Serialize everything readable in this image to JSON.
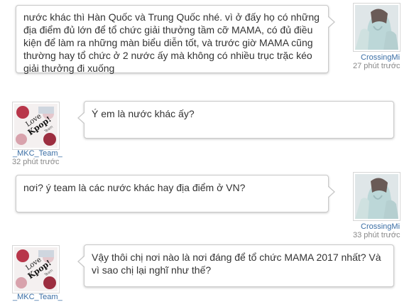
{
  "messages": [
    {
      "user": "CrossingMi",
      "time": "27 phút trước",
      "text": "nước khác thì Hàn Quốc và Trung Quốc nhé. vì ở đấy họ có những địa điểm đủ lớn để tổ chức giải thưởng tầm cỡ MAMA, có đủ điều kiện để làm ra những màn biểu diễn tốt, và trước giờ MAMA cũng thường hay tổ chức ở 2 nước ấy mà không có nhiều trục trặc kéo giải thưởng đi xuống"
    },
    {
      "user": "_MKC_Team_",
      "time": "32 phút trước",
      "text": "Ý em là nước khác ấy?",
      "avatar_text": [
        "Love",
        "Kpop!",
        "Team"
      ]
    },
    {
      "user": "CrossingMi",
      "time": "33 phút trước",
      "text": "nơi? ý team là các nước khác hay địa điểm ở VN?"
    },
    {
      "user": "_MKC_Team_",
      "text": "Vậy thôi chị nơi nào là nơi đáng để tổ chức MAMA 2017 nhất? Và vì sao chị lại nghĩ như thế?",
      "avatar_text": [
        "Love",
        "Kpop!",
        "Team"
      ]
    }
  ],
  "colors": {
    "username": "#3a6ea5",
    "timestamp": "#888888",
    "bubble_border": "#c9c9c9",
    "text": "#333333"
  }
}
